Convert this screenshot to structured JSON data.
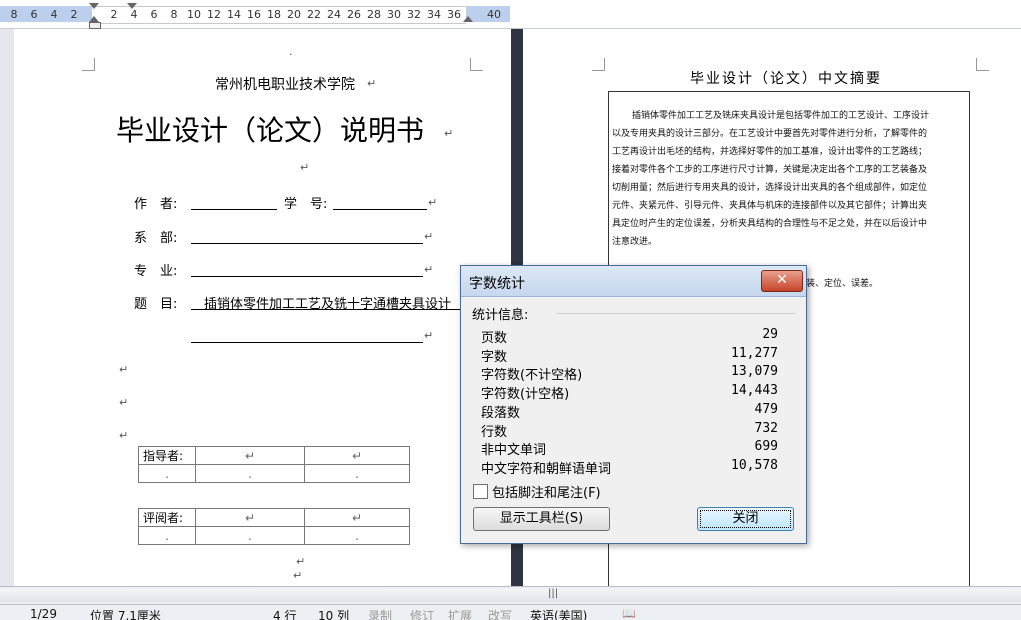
{
  "ruler": {
    "ticks": [
      "8",
      "6",
      "4",
      "2",
      "2",
      "4",
      "6",
      "8",
      "10",
      "12",
      "14",
      "16",
      "18",
      "20",
      "22",
      "24",
      "26",
      "28",
      "30",
      "32",
      "34",
      "36",
      "40"
    ]
  },
  "page_left": {
    "institution": "常州机电职业技术学院",
    "title": "毕业设计（论文）说明书",
    "field_author": "作　者:",
    "field_student_no": "学　号:",
    "field_department": "系　部:",
    "field_major": "专　业:",
    "field_topic": "题　目:",
    "topic_value": "插销体零件加工工艺及铣十字通槽夹具设计",
    "advisor_label": "指导者:",
    "reviewer_label": "评阅者:"
  },
  "page_right": {
    "heading": "毕业设计（论文）中文摘要",
    "abstract_lines": [
      "插销体零件加工工艺及铣床夹具设计是包括零件加工的工艺设计、工序设计",
      "以及专用夹具的设计三部分。在工艺设计中要首先对零件进行分析，了解零件的",
      "工艺再设计出毛坯的结构，并选择好零件的加工基准，设计出零件的工艺路线；",
      "接着对零件各个工步的工序进行尺寸计算，关键是决定出各个工序的工艺装备及",
      "切削用量；然后进行专用夹具的设计，选择设计出夹具的各个组成部件，如定位",
      "元件、夹紧元件、引导元件、夹具体与机床的连接部件以及其它部件；计算出夹",
      "具定位时产生的定位误差，分析夹具结构的合理性与不足之处，并在以后设计中",
      "注意改进。"
    ],
    "keywords_tail": "装、定位、误差。"
  },
  "dialog": {
    "title": "字数统计",
    "section_label": "统计信息:",
    "stats": [
      {
        "label": "页数",
        "value": "29"
      },
      {
        "label": "字数",
        "value": "11,277"
      },
      {
        "label": "字符数(不计空格)",
        "value": "13,079"
      },
      {
        "label": "字符数(计空格)",
        "value": "14,443"
      },
      {
        "label": "段落数",
        "value": "479"
      },
      {
        "label": "行数",
        "value": "732"
      },
      {
        "label": "非中文单词",
        "value": "699"
      },
      {
        "label": "中文字符和朝鲜语单词",
        "value": "10,578"
      }
    ],
    "checkbox_label": "包括脚注和尾注(F)",
    "checkbox_checked": false,
    "toolbar_button": "显示工具栏(S)",
    "close_button": "关闭",
    "close_glyph": "✕"
  },
  "hscroll": {
    "grip": "|||"
  },
  "status": {
    "page": "1/29",
    "position": "位置 7.1厘米",
    "row": "4 行",
    "col": "10 列",
    "record": "录制",
    "revise": "修订",
    "extend": "扩展",
    "overwrite": "改写",
    "language": "英语(美国)"
  },
  "colors": {
    "workspace": "#d6dce6",
    "ruler_margin": "#bcd0ee",
    "dialog_title": "#c6d7ee",
    "close_red": "#c8442b"
  }
}
